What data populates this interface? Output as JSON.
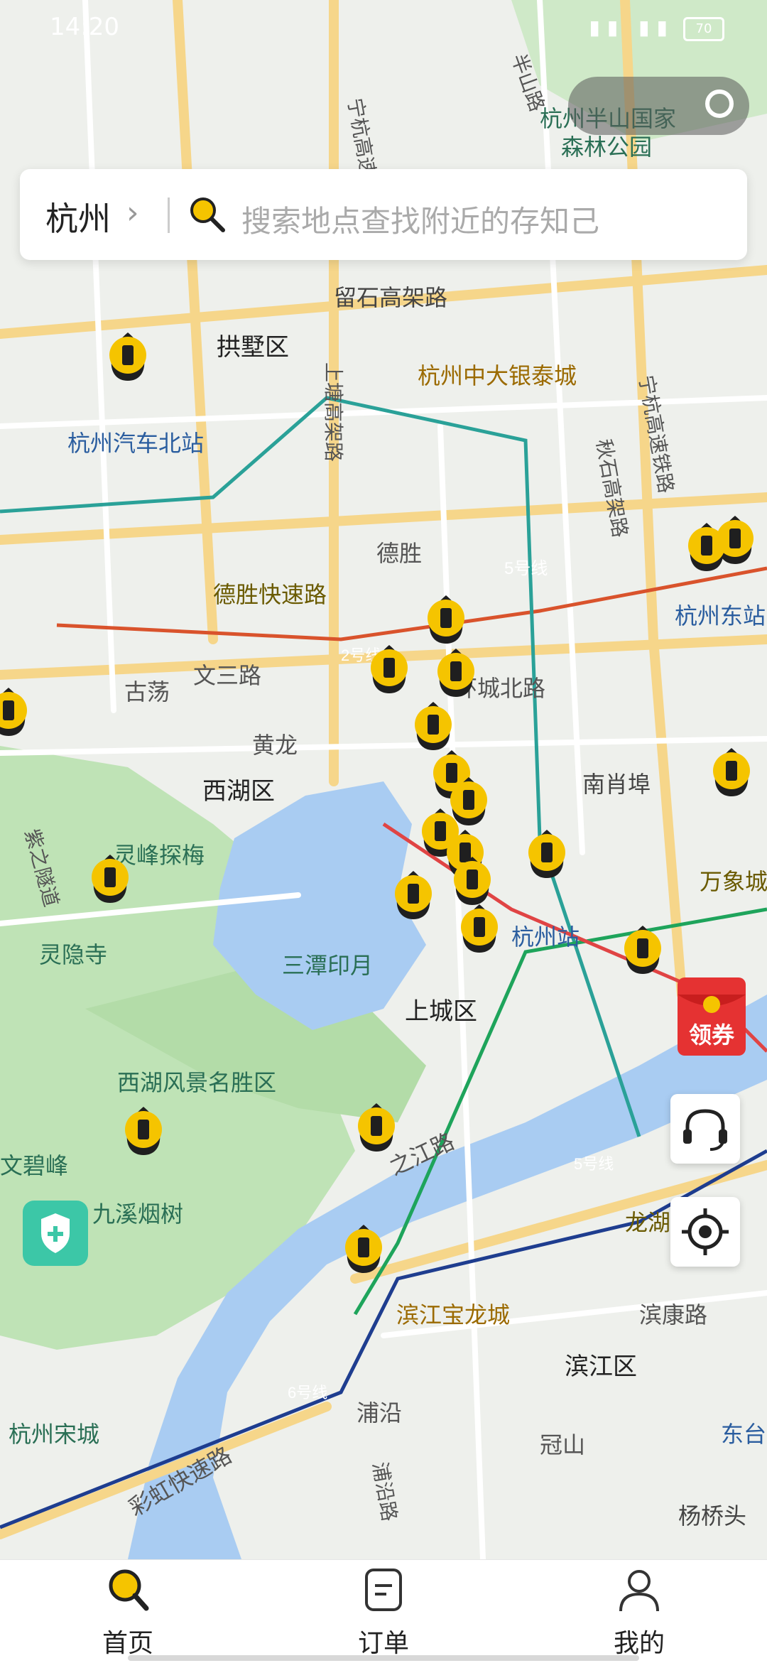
{
  "status_bar": {
    "time": "14:20",
    "battery": "70"
  },
  "search": {
    "city": "杭州",
    "placeholder": "搜索地点查找附近的存知己"
  },
  "floating": {
    "coupon_label": "领券"
  },
  "tabs": [
    {
      "label": "首页",
      "icon": "search-icon",
      "active": true
    },
    {
      "label": "订单",
      "icon": "order-list-icon",
      "active": false
    },
    {
      "label": "我的",
      "icon": "profile-icon",
      "active": false
    }
  ],
  "map": {
    "labels": [
      "杭州半山国家",
      "森林公园",
      "宁杭高速铁路",
      "半山路",
      "留石高架路",
      "拱墅区",
      "杭州中大银泰城",
      "杭州汽车北站",
      "上塘高架路",
      "秋石高架路",
      "宁杭高速铁路",
      "德胜",
      "5号线",
      "德胜快速路",
      "杭州东站",
      "古荡",
      "文三路",
      "2号线",
      "环城北路",
      "黄龙",
      "西湖区",
      "南肖埠",
      "灵峰探梅",
      "灵隐寺",
      "三潭印月",
      "杭州站",
      "万象城",
      "上城区",
      "西湖风景名胜区",
      "文碧峰",
      "九溪烟树",
      "之江路",
      "5号线",
      "龙湖滨江",
      "滨江宝龙城",
      "滨康路",
      "滨江区",
      "6号线",
      "浦沿",
      "冠山",
      "杭州宋城",
      "彩虹快速路",
      "浦沿路",
      "杨桥头",
      "东台",
      "紫之隧道"
    ]
  },
  "colors": {
    "accent": "#f5c400",
    "marker_dark": "#1f1f1f"
  }
}
